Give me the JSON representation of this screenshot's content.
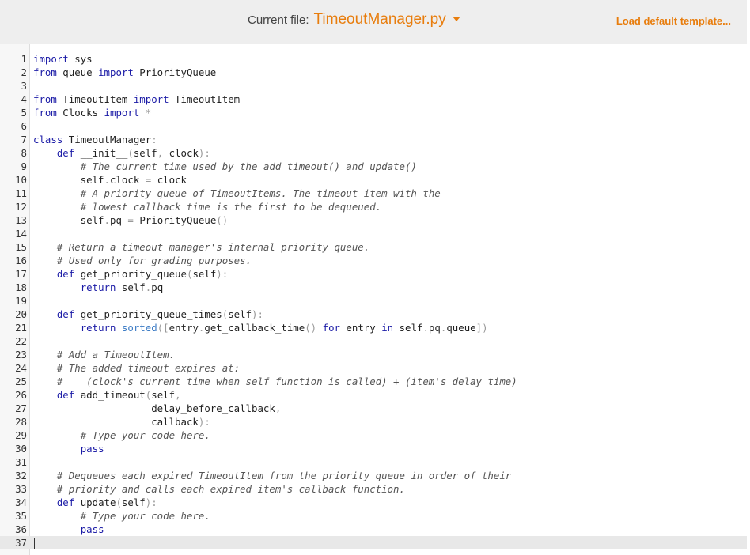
{
  "header": {
    "file_label": "Current file:",
    "file_name": "TimeoutManager.py",
    "load_template": "Load default template...",
    "accent_color": "#e87d0d"
  },
  "editor": {
    "cursor_line": 37,
    "lines": [
      "import sys",
      "from queue import PriorityQueue",
      "",
      "from TimeoutItem import TimeoutItem",
      "from Clocks import *",
      "",
      "class TimeoutManager:",
      "    def __init__(self, clock):",
      "        # The current time used by the add_timeout() and update()",
      "        self.clock = clock",
      "        # A priority queue of TimeoutItems. The timeout item with the",
      "        # lowest callback time is the first to be dequeued.",
      "        self.pq = PriorityQueue()",
      "",
      "    # Return a timeout manager's internal priority queue.",
      "    # Used only for grading purposes.",
      "    def get_priority_queue(self):",
      "        return self.pq",
      "",
      "    def get_priority_queue_times(self):",
      "        return sorted([entry.get_callback_time() for entry in self.pq.queue])",
      "",
      "    # Add a TimeoutItem.",
      "    # The added timeout expires at:",
      "    #    (clock's current time when self function is called) + (item's delay time)",
      "    def add_timeout(self,",
      "                    delay_before_callback,",
      "                    callback):",
      "        # Type your code here.",
      "        pass",
      "",
      "    # Dequeues each expired TimeoutItem from the priority queue in order of their",
      "    # priority and calls each expired item's callback function.",
      "    def update(self):",
      "        # Type your code here.",
      "        pass",
      ""
    ]
  }
}
